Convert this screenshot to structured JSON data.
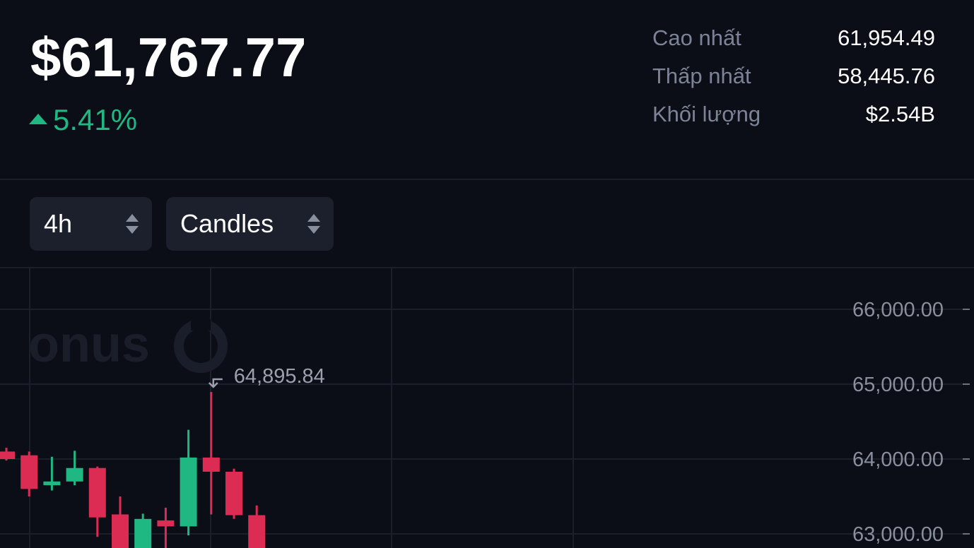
{
  "ticker": {
    "price": "$61,767.77",
    "change": "5.41%",
    "change_direction": "up",
    "up_color": "#1fb883",
    "down_color": "#dd2c54"
  },
  "stats": {
    "high_label": "Cao nhất",
    "high_value": "61,954.49",
    "low_label": "Thấp nhất",
    "low_value": "58,445.76",
    "volume_label": "Khối lượng",
    "volume_value": "$2.54B"
  },
  "controls": {
    "interval": "4h",
    "chart_type": "Candles"
  },
  "chart": {
    "watermark": "onus",
    "peak_label": "64,895.84"
  },
  "chart_data": {
    "type": "candlestick",
    "y_tick_labels": [
      "66,000.00",
      "65,000.00",
      "64,000.00",
      "63,000.00"
    ],
    "y_ticks": [
      66000,
      65000,
      64000,
      63000
    ],
    "candles": [
      {
        "open": 64100,
        "close": 64000,
        "high": 64150,
        "low": 63980,
        "dir": "down"
      },
      {
        "open": 64050,
        "close": 63600,
        "high": 64100,
        "low": 63500,
        "dir": "down"
      },
      {
        "open": 63650,
        "close": 63700,
        "high": 64030,
        "low": 63580,
        "dir": "up"
      },
      {
        "open": 63700,
        "close": 63880,
        "high": 64110,
        "low": 63650,
        "dir": "up"
      },
      {
        "open": 63880,
        "close": 63220,
        "high": 63900,
        "low": 62960,
        "dir": "down"
      },
      {
        "open": 63260,
        "close": 62800,
        "high": 63500,
        "low": 62800,
        "dir": "down"
      },
      {
        "open": 62800,
        "close": 63200,
        "high": 63270,
        "low": 62800,
        "dir": "up"
      },
      {
        "open": 63180,
        "close": 63100,
        "high": 63350,
        "low": 62800,
        "dir": "down"
      },
      {
        "open": 63100,
        "close": 64020,
        "high": 64390,
        "low": 62980,
        "dir": "up"
      },
      {
        "open": 64020,
        "close": 63830,
        "high": 64896,
        "low": 63260,
        "dir": "down"
      },
      {
        "open": 63830,
        "close": 63250,
        "high": 63870,
        "low": 63200,
        "dir": "down"
      },
      {
        "open": 63250,
        "close": 62800,
        "high": 63380,
        "low": 62800,
        "dir": "down"
      }
    ]
  }
}
